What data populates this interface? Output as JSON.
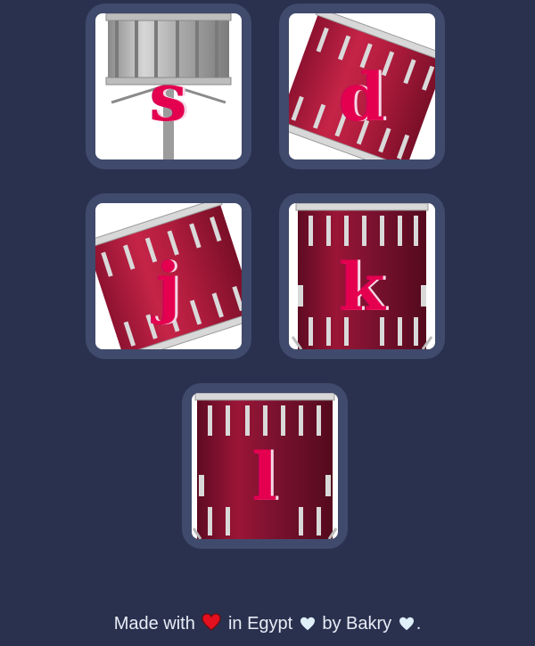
{
  "drums": [
    {
      "key": "s",
      "drum": "snare",
      "rotated": false
    },
    {
      "key": "d",
      "drum": "tom-1",
      "rotated": true
    },
    {
      "key": "j",
      "drum": "tom-2",
      "rotated": true
    },
    {
      "key": "k",
      "drum": "tom-3",
      "rotated": false
    },
    {
      "key": "l",
      "drum": "kick-bass",
      "rotated": false
    }
  ],
  "footer": {
    "made_with": "Made with",
    "in_country": "in Egypt",
    "by_author": "by Bakry",
    "end": ".",
    "hearts": [
      "red-heart-icon",
      "white-heart-icon",
      "white-heart-icon"
    ]
  },
  "colors": {
    "background": "#2a314e",
    "button_frame": "#404a6c",
    "letter": "#e4004f",
    "drum_red": "#b3193c",
    "drum_dark": "#7c1430"
  }
}
